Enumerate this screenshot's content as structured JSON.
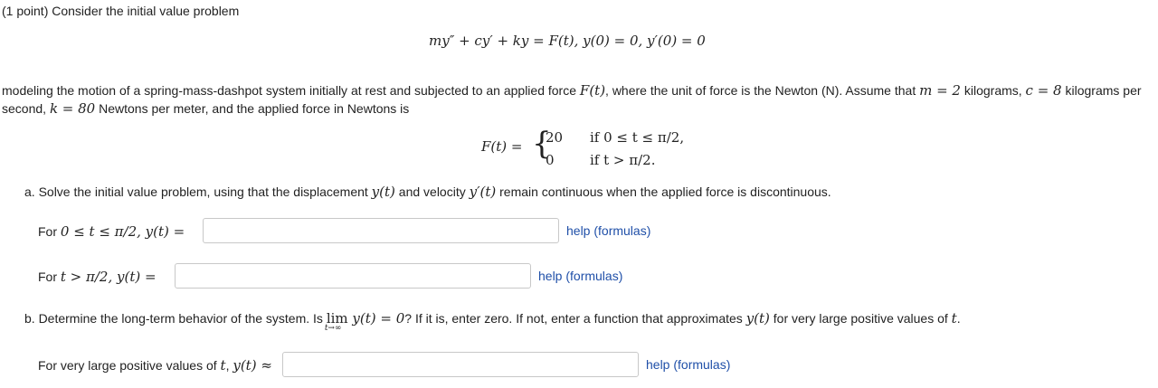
{
  "problem": {
    "header": "(1 point) Consider the initial value problem",
    "ode": "my″ + cy′ + ky = F(t),   y(0) = 0,   y′(0) = 0",
    "intro_part1": "modeling the motion of a spring-mass-dashpot system initially at rest and subjected to an applied force ",
    "intro_Ft": "F(t)",
    "intro_part2": ", where the unit of force is the Newton (N). Assume that ",
    "m_eq": "m = 2",
    "kg_text": " kilograms, ",
    "c_eq": "c = 8",
    "c_units": " kilograms per",
    "line2_a": "second, ",
    "k_eq": "k = 80",
    "line2_b": " Newtons per meter, and the applied force in Newtons is"
  },
  "piecewise": {
    "lhs": "F(t) =",
    "val1": "20",
    "cond1": "if 0 ≤ t ≤ π/2,",
    "val2": "0",
    "cond2": "if t > π/2."
  },
  "part_a": {
    "prompt1": "a. Solve the initial value problem, using that the displacement ",
    "yt": "y(t)",
    "prompt2": " and velocity ",
    "ypt": "y′(t)",
    "prompt3": " remain continuous when the applied force is discontinuous.",
    "row1_prefix": "For ",
    "row1_cond": "0 ≤ t ≤ π/2,  y(t) =",
    "row1_value": "",
    "row2_prefix": "For ",
    "row2_cond": "t > π/2,  y(t) =",
    "row2_value": ""
  },
  "part_b": {
    "prompt1": "b. Determine the long-term behavior of the system. Is ",
    "lim": "lim",
    "lim_sub": "t→∞",
    "lim_expr": " y(t) = 0",
    "prompt2": "? If it is, enter zero. If not, enter a function that approximates ",
    "yt": "y(t)",
    "prompt3": " for very large positive values of ",
    "t": "t",
    "prompt4": ".",
    "row_prefix": "For very large positive values of ",
    "row_t": "t",
    "row_comma": ", ",
    "row_expr": "y(t) ≈",
    "row_value": ""
  },
  "help_label": "help (formulas)"
}
